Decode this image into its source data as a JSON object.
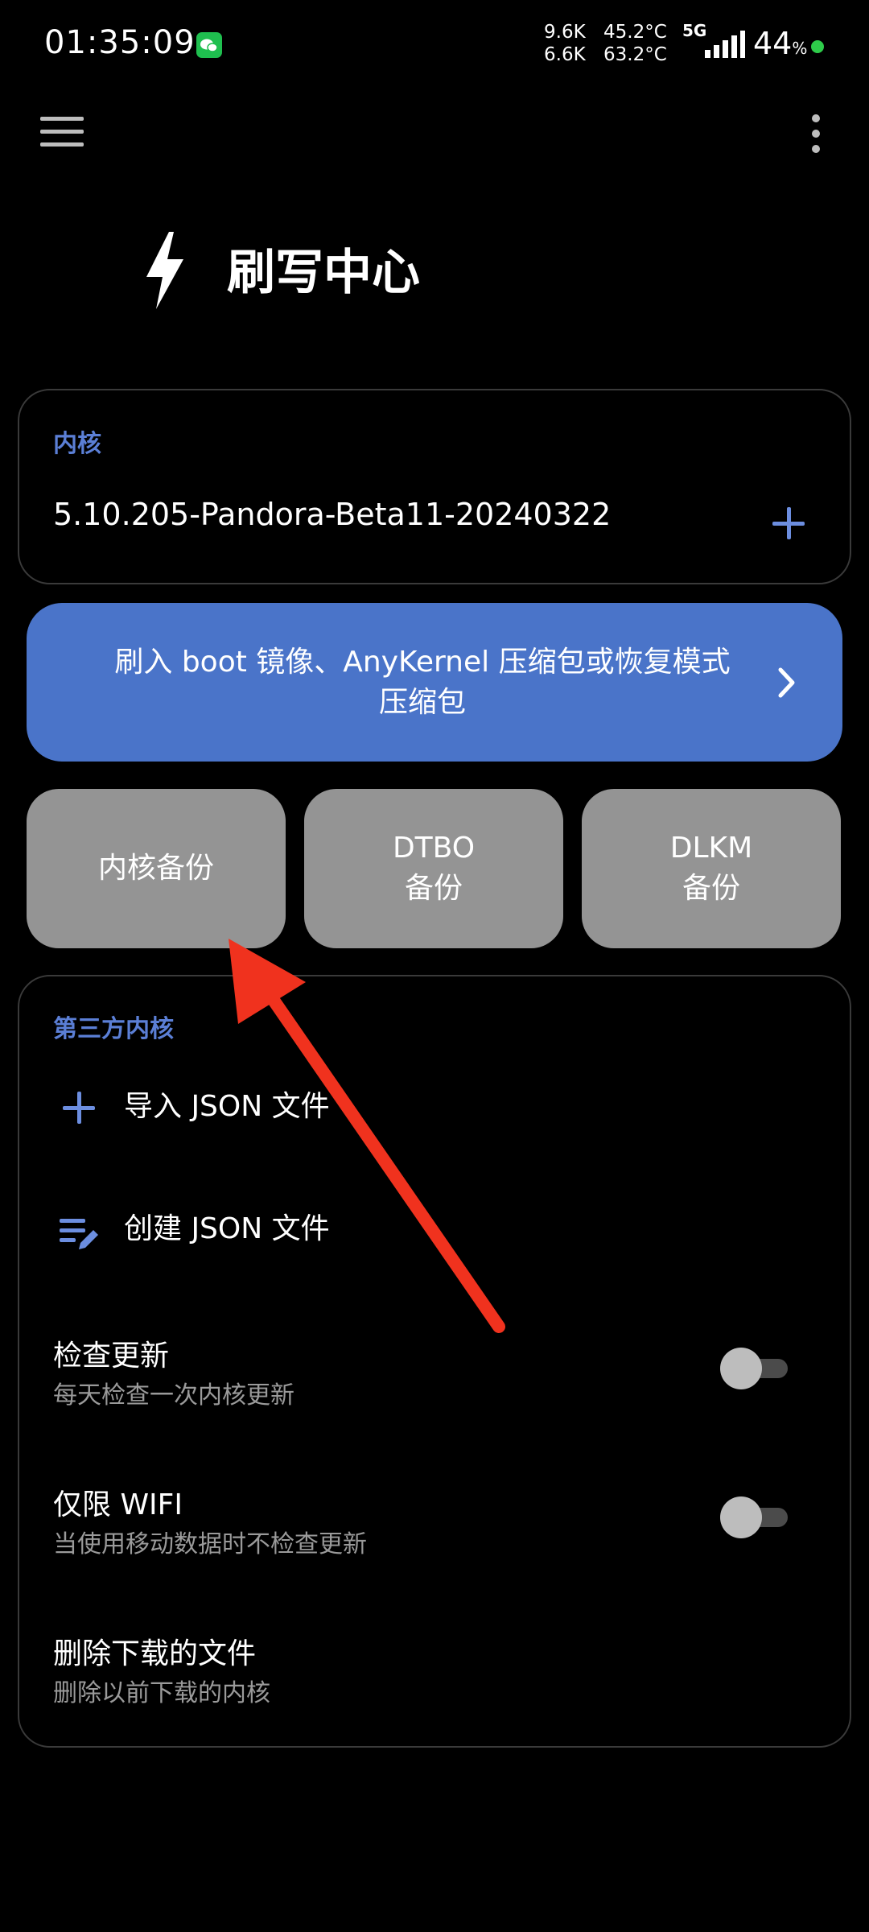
{
  "status_bar": {
    "time": "01:35:09",
    "net_up": "9.6K",
    "net_down": "6.6K",
    "temp_1": "45.2°C",
    "temp_2": "63.2°C",
    "network": "5G",
    "battery": "44",
    "battery_unit": "%",
    "icons": [
      "wechat-icon",
      "signal-icon",
      "battery-dot-icon"
    ]
  },
  "app_bar": {
    "icons": [
      "menu-icon",
      "more-options-icon"
    ]
  },
  "header": {
    "title": "刷写中心",
    "icon": "bolt-icon"
  },
  "kernel_card": {
    "label": "内核",
    "version": "5.10.205-Pandora-Beta11-20240322",
    "icon": "plus-icon"
  },
  "flash_button": {
    "label": "刷入 boot 镜像、AnyKernel 压缩包或恢复模式压缩包",
    "icon": "chevron-right-icon"
  },
  "backup_buttons": [
    {
      "label": "内核备份"
    },
    {
      "label": "DTBO\n备份"
    },
    {
      "label": "DLKM\n备份"
    }
  ],
  "third_party": {
    "label": "第三方内核",
    "import_label": "导入 JSON 文件",
    "create_label": "创建 JSON 文件",
    "settings": [
      {
        "title": "检查更新",
        "subtitle": "每天检查一次内核更新",
        "enabled": false
      },
      {
        "title": "仅限 WIFI",
        "subtitle": "当使用移动数据时不检查更新",
        "enabled": false
      },
      {
        "title": "删除下载的文件",
        "subtitle": "删除以前下载的内核"
      }
    ]
  },
  "colors": {
    "accent": "#4a74c9",
    "label_blue": "#5b7fd6",
    "backup_gray": "#949494",
    "annotation_arrow": "#f0321e"
  }
}
